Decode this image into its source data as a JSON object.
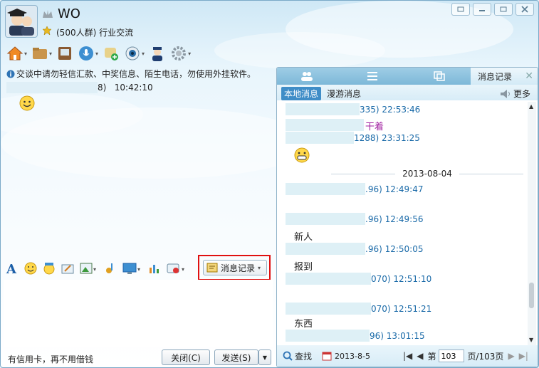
{
  "header": {
    "name": "WO",
    "group_info": "(500人群) 行业交流"
  },
  "left": {
    "notice": "交谈中请勿轻信汇款、中奖信息、陌生电话，勿使用外挂软件。",
    "msg_meta_end": "8)",
    "msg_time": "10:42:10",
    "history_button": "消息记录",
    "ad_text": "有信用卡，再不用借钱",
    "close_button": "关闭(C)",
    "send_button": "发送(S)"
  },
  "right": {
    "active_tab": "消息记录",
    "local_tab": "本地消息",
    "roaming_tab": "漫游消息",
    "more": "更多",
    "messages": [
      {
        "meta": "335) 22:53:46"
      },
      {
        "text_purple": "干着"
      },
      {
        "meta": "1288) 23:31:25"
      },
      {
        "date": "2013-08-04"
      },
      {
        "meta": ".96) 12:49:47"
      },
      {
        "meta": ".96) 12:49:56",
        "text": "新人"
      },
      {
        "meta": ".96) 12:50:05",
        "text": "报到"
      },
      {
        "meta": "070) 12:51:10"
      },
      {
        "meta": "070) 12:51:21",
        "text": "东西"
      },
      {
        "meta": "96) 13:01:15"
      }
    ],
    "find": "查找",
    "date_filter": "2013-8-5",
    "page_prefix": "第",
    "page_value": "103",
    "page_suffix": "页/103页"
  },
  "colors": {
    "accent": "#3f8dc7",
    "meta_blue": "#1a6aa8",
    "highlight_red": "#e01010",
    "purple": "#a020a0"
  }
}
